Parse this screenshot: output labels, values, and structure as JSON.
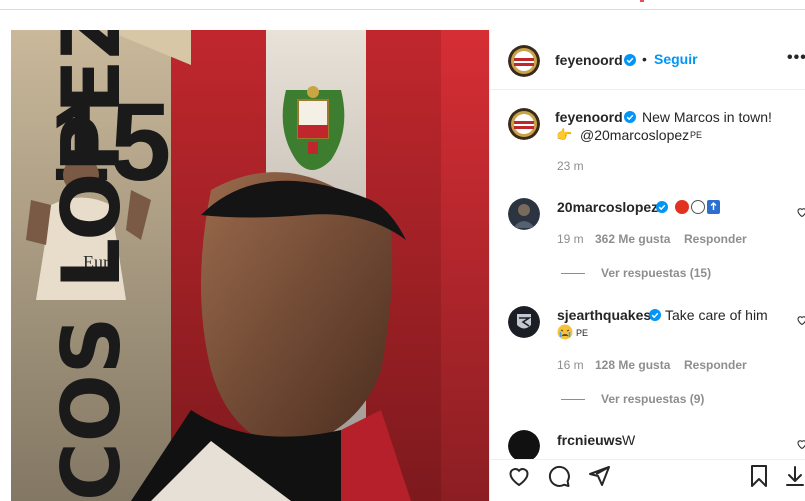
{
  "post": {
    "author": "feyenoord",
    "follow_label": "Seguir",
    "separator": "•",
    "more_label": "•••",
    "poster": {
      "number": "15",
      "name": "LOPEZ",
      "name_partial": "COS",
      "shirt_text": "Euro"
    }
  },
  "caption": {
    "username": "feyenoord",
    "text": "New Marcos in town!",
    "line2_mention": "@20marcoslopez",
    "line2_tag": "PE",
    "time": "23 m"
  },
  "comments": [
    {
      "username": "20marcoslopez",
      "time": "19 m",
      "likes": "362 Me gusta",
      "reply": "Responder",
      "view_replies": "Ver respuestas (15)"
    },
    {
      "username": "sjearthquakes",
      "text": "Take care of him",
      "line2_tag": "PE",
      "time": "16 m",
      "likes": "128 Me gusta",
      "reply": "Responder",
      "view_replies": "Ver respuestas (9)"
    },
    {
      "username": "frcnieuws",
      "text": "W"
    }
  ],
  "icons": [
    "verified-badge-icon",
    "heart-icon",
    "comment-icon",
    "share-icon",
    "bookmark-icon",
    "download-icon"
  ],
  "colors": {
    "accent": "#0095f6",
    "verified": "#0095f6",
    "flag_red": "#c0272d",
    "muted": "#8e8e8e"
  }
}
